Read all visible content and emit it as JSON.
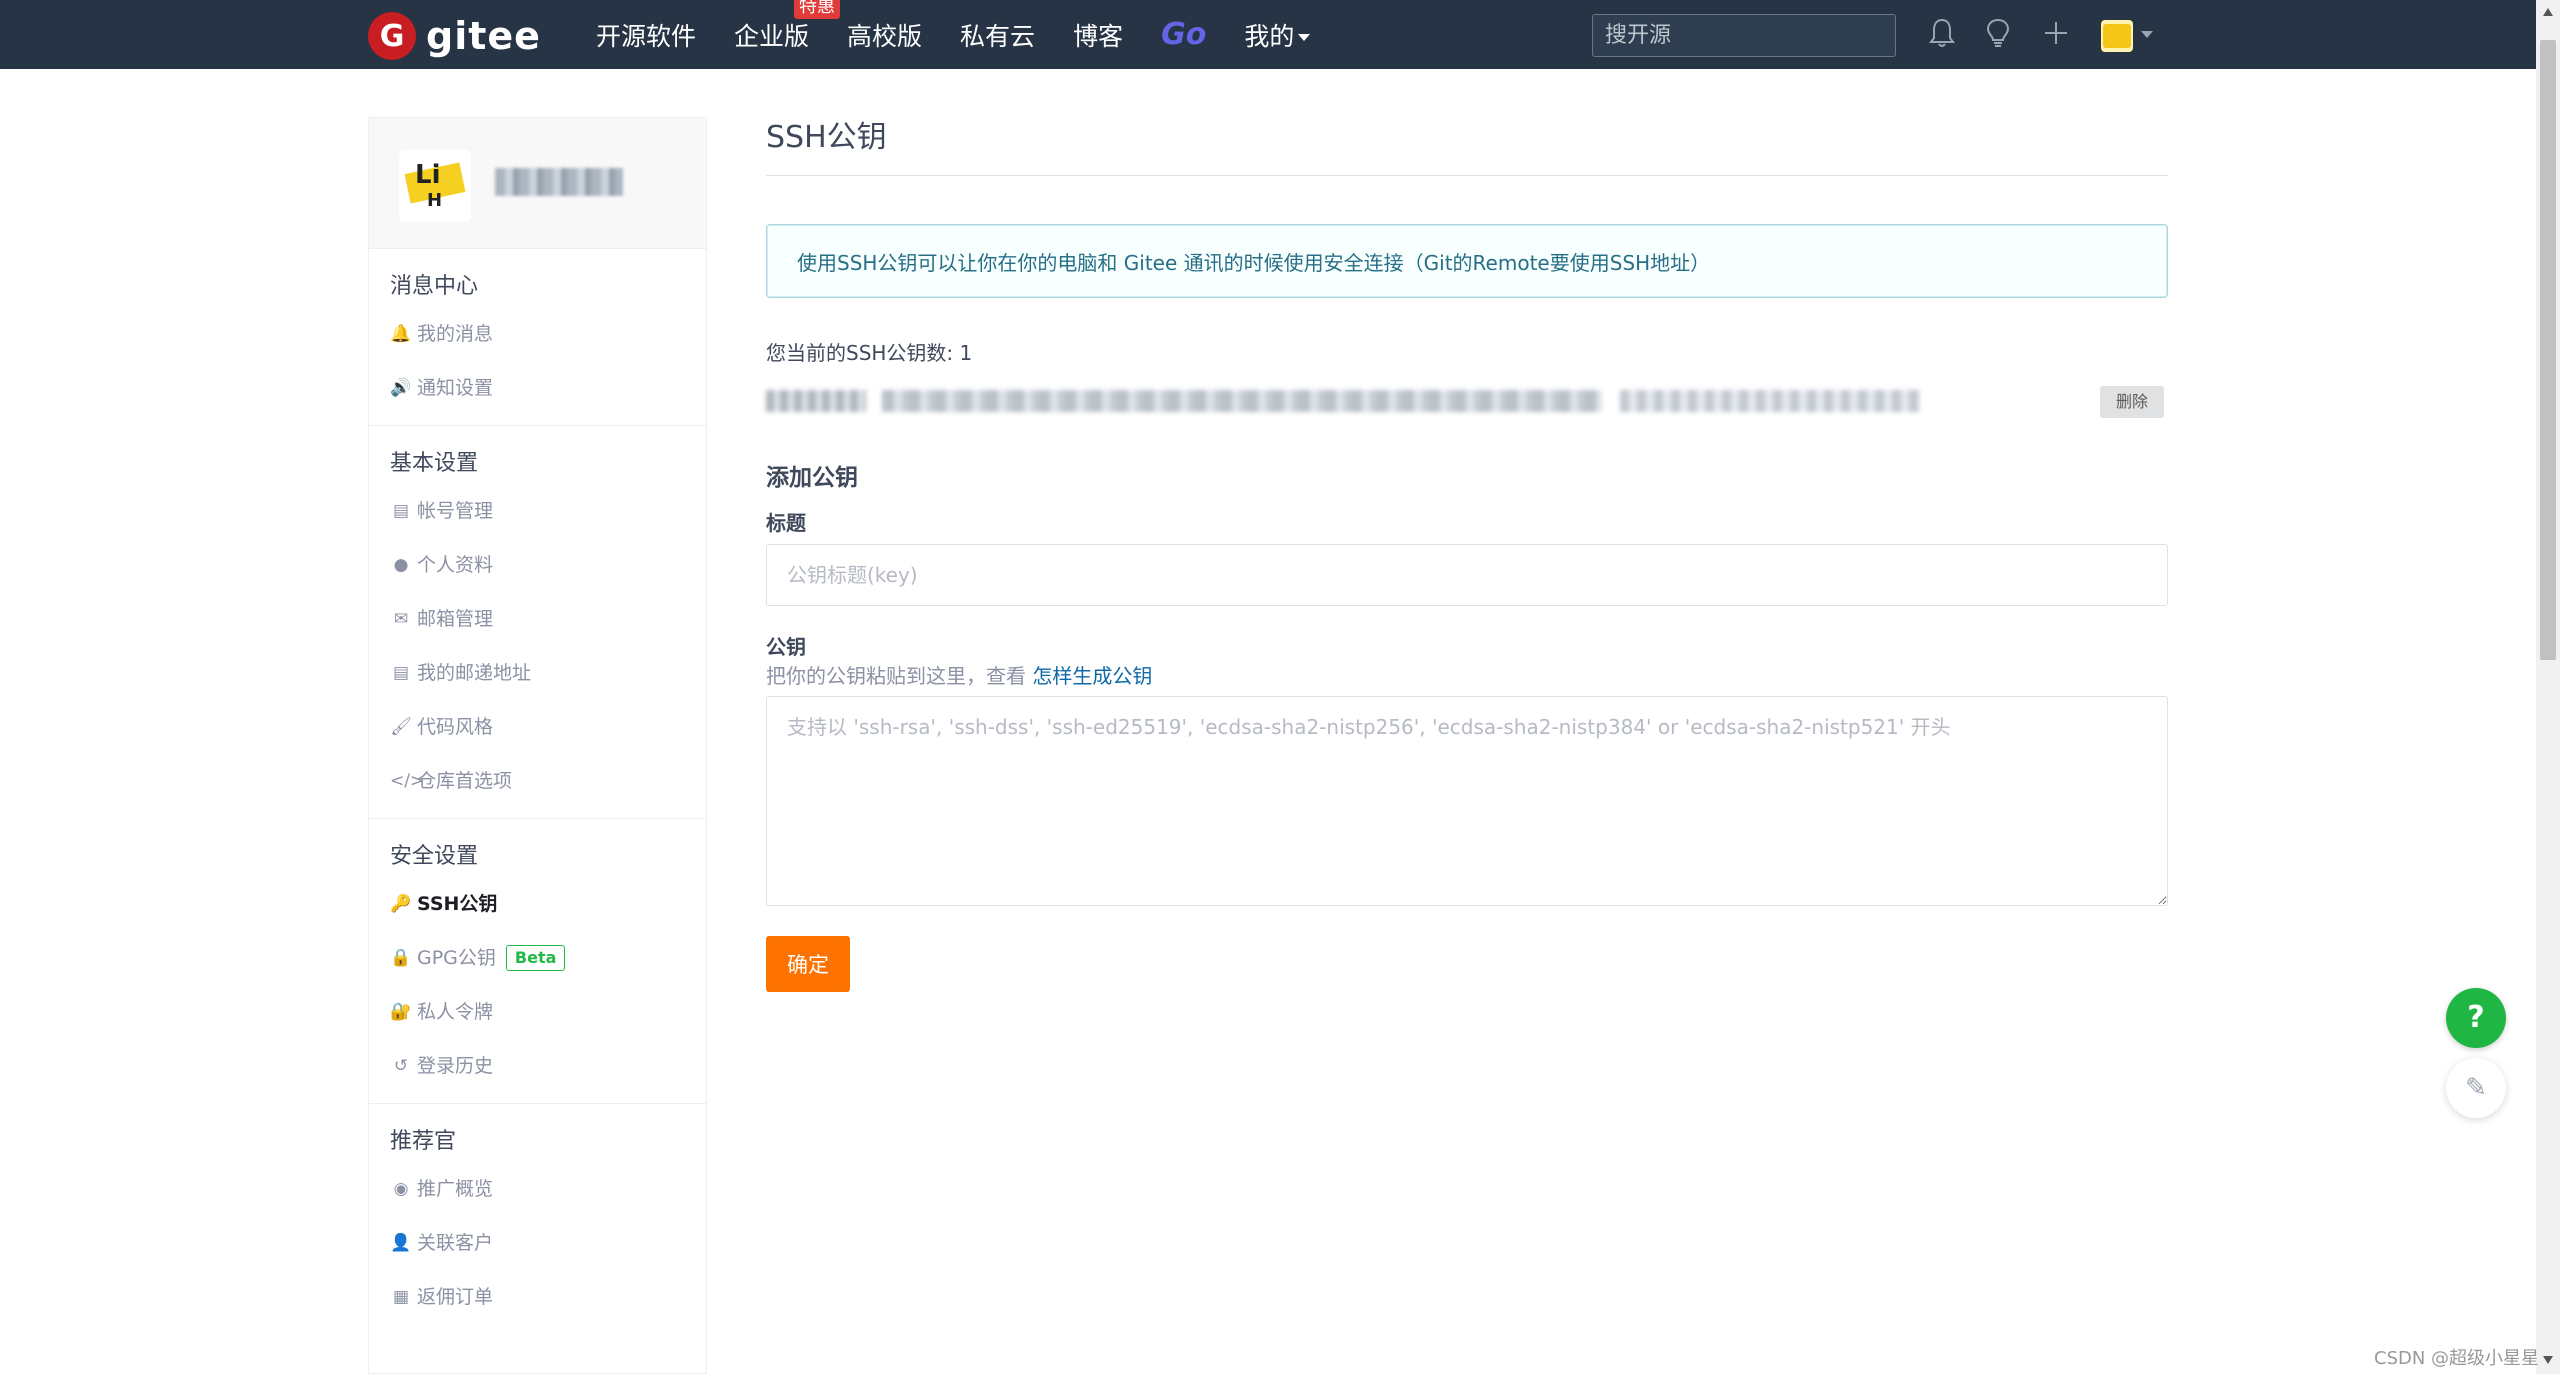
{
  "header": {
    "logo_mark": "G",
    "logo_text": "gitee",
    "nav": [
      "开源软件",
      "企业版",
      "高校版",
      "私有云",
      "博客"
    ],
    "enterprise_badge": "特惠",
    "go_label": "Go",
    "mine_label": "我的",
    "search_placeholder": "搜开源",
    "icons": [
      "bell-icon",
      "lightbulb-icon",
      "plus-icon"
    ]
  },
  "sidebar": {
    "groups": [
      {
        "title": "消息中心",
        "items": [
          {
            "icon": "bell-icon",
            "glyph": "🔔",
            "label": "我的消息"
          },
          {
            "icon": "speaker-icon",
            "glyph": "🔊",
            "label": "通知设置"
          }
        ]
      },
      {
        "title": "基本设置",
        "items": [
          {
            "icon": "id-card-icon",
            "glyph": "▤",
            "label": "帐号管理"
          },
          {
            "icon": "user-icon",
            "glyph": "●",
            "label": "个人资料"
          },
          {
            "icon": "mail-icon",
            "glyph": "✉",
            "label": "邮箱管理"
          },
          {
            "icon": "address-card-icon",
            "glyph": "▤",
            "label": "我的邮递地址"
          },
          {
            "icon": "brush-icon",
            "glyph": "🖌",
            "label": "代码风格"
          },
          {
            "icon": "code-icon",
            "glyph": "</>",
            "label": "仓库首选项"
          }
        ]
      },
      {
        "title": "安全设置",
        "items": [
          {
            "icon": "key-icon",
            "glyph": "🔑",
            "label": "SSH公钥",
            "active": true
          },
          {
            "icon": "lock-icon",
            "glyph": "🔒",
            "label": "GPG公钥",
            "badge": "Beta"
          },
          {
            "icon": "token-lock-icon",
            "glyph": "🔐",
            "label": "私人令牌"
          },
          {
            "icon": "history-icon",
            "glyph": "↺",
            "label": "登录历史"
          }
        ]
      },
      {
        "title": "推荐官",
        "items": [
          {
            "icon": "dashboard-icon",
            "glyph": "◉",
            "label": "推广概览"
          },
          {
            "icon": "user-link-icon",
            "glyph": "👤",
            "label": "关联客户"
          },
          {
            "icon": "order-icon",
            "glyph": "▦",
            "label": "返佣订单"
          }
        ]
      }
    ]
  },
  "main": {
    "title": "SSH公钥",
    "info": "使用SSH公钥可以让你在你的电脑和 Gitee 通讯的时候使用安全连接（Git的Remote要使用SSH地址）",
    "key_count_label": "您当前的SSH公钥数: 1",
    "delete_label": "删除",
    "add_title": "添加公钥",
    "title_label": "标题",
    "title_placeholder": "公钥标题(key)",
    "key_label": "公钥",
    "key_hint": "把你的公钥粘贴到这里，查看 ",
    "key_hint_link": "怎样生成公钥",
    "key_placeholder": "支持以 'ssh-rsa', 'ssh-dss', 'ssh-ed25519', 'ecdsa-sha2-nistp256', 'ecdsa-sha2-nistp384' or 'ecdsa-sha2-nistp521' 开头",
    "confirm_label": "确定"
  },
  "float": {
    "help_label": "?",
    "feedback_glyph": "✎"
  },
  "watermark": "CSDN @超级小星星",
  "colors": {
    "nav_bg": "#263445",
    "primary_orange": "#fe7300",
    "help_green": "#1fb644",
    "link_blue": "#0f69a8",
    "beta_green": "#21ba45"
  }
}
